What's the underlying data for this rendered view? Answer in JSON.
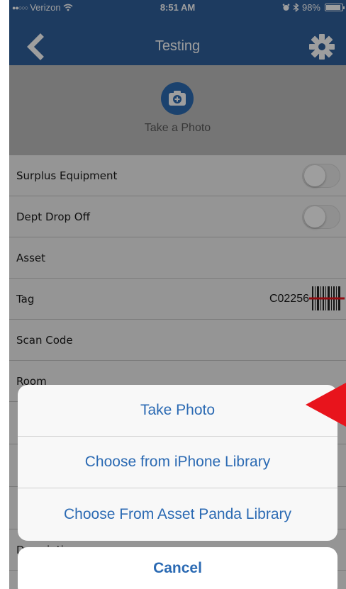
{
  "status_bar": {
    "carrier": "Verizon",
    "time": "8:51 AM",
    "battery": "98%",
    "battery_level": 0.98
  },
  "nav": {
    "title": "Testing",
    "back_icon": "chevron-left-icon",
    "settings_icon": "gear-icon"
  },
  "photo": {
    "label": "Take a Photo",
    "icon": "camera-plus-icon"
  },
  "form": {
    "rows": [
      {
        "label": "Surplus Equipment",
        "type": "toggle",
        "on": false
      },
      {
        "label": "Dept Drop Off",
        "type": "toggle",
        "on": false
      },
      {
        "label": "Asset"
      },
      {
        "label": "Tag",
        "value": "C02256",
        "icon": "barcode-icon"
      },
      {
        "label": "Scan Code"
      },
      {
        "label": "Room"
      },
      {
        "label": "Description"
      }
    ]
  },
  "action_sheet": {
    "options": [
      "Take Photo",
      "Choose from iPhone Library",
      "Choose From Asset Panda Library"
    ],
    "cancel": "Cancel"
  },
  "colors": {
    "nav_blue": "#2f5f9c",
    "action_blue": "#2b6ab3",
    "arrow_red": "#e8141c"
  }
}
